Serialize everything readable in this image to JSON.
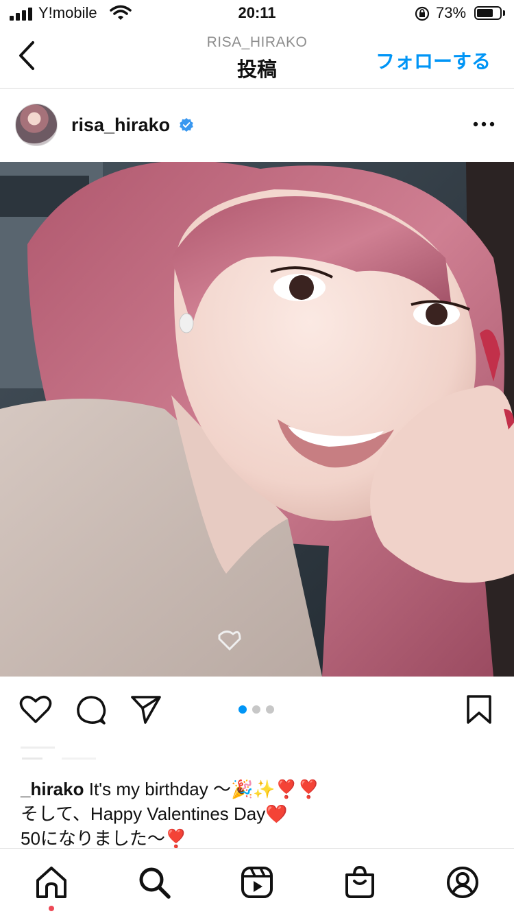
{
  "status_bar": {
    "carrier": "Y!mobile",
    "time": "20:11",
    "battery_percent": "73%",
    "battery_level": 0.73
  },
  "header": {
    "username": "RISA_HIRAKO",
    "title": "投稿",
    "follow_label": "フォローする"
  },
  "post": {
    "author": "risa_hirako",
    "verified": true,
    "carousel": {
      "count": 3,
      "active_index": 0
    },
    "caption": {
      "username": "_hirako",
      "line1": "It's my birthday 〜🎉✨❣️❣️",
      "line2": "そして、Happy Valentines Day❤️",
      "line3": "50になりました〜❣️"
    }
  },
  "icons": {
    "back": "chevron-left-icon",
    "more": "more-horizontal-icon",
    "like": "heart-icon",
    "comment": "comment-icon",
    "share": "send-icon",
    "save": "bookmark-icon",
    "tabs": [
      "home-icon",
      "search-icon",
      "reels-icon",
      "shop-icon",
      "profile-icon"
    ]
  },
  "colors": {
    "accent": "#0095f6",
    "notification": "#ed4956"
  }
}
